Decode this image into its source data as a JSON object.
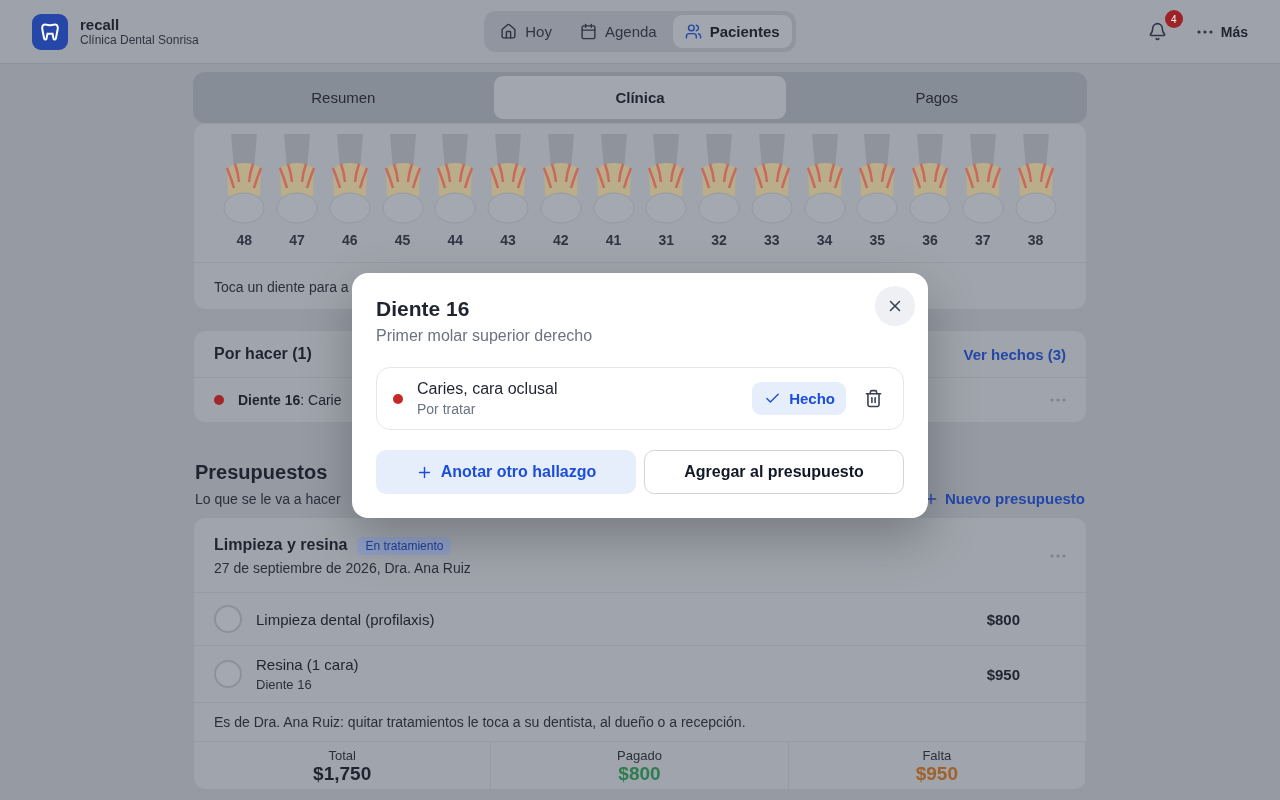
{
  "header": {
    "app_name": "recall",
    "clinic": "Clínica Dental Sonrisa",
    "nav": [
      {
        "label": "Hoy",
        "selected": false
      },
      {
        "label": "Agenda",
        "selected": false
      },
      {
        "label": "Pacientes",
        "selected": true
      }
    ],
    "notifications": "4",
    "more": "Más"
  },
  "tabs": [
    {
      "label": "Resumen",
      "selected": false
    },
    {
      "label": "Clínica",
      "selected": true
    },
    {
      "label": "Pagos",
      "selected": false
    }
  ],
  "odontogram": {
    "teeth": [
      "48",
      "47",
      "46",
      "45",
      "44",
      "43",
      "42",
      "41",
      "31",
      "32",
      "33",
      "34",
      "35",
      "36",
      "37",
      "38"
    ],
    "hint": "Toca un diente para a"
  },
  "todo": {
    "title": "Por hacer (1)",
    "link": "Ver hechos (3)",
    "items": [
      {
        "text": "**Diente 16**: Carie",
        "color": "#a3262a"
      }
    ]
  },
  "budgets": {
    "title": "Presupuestos",
    "subtitle": "Lo que se le va a hacer",
    "new_button": "Nuevo presupuesto",
    "cards": [
      {
        "title": "Limpieza y resina",
        "status": "En tratamiento",
        "meta": "27 de septiembre de 2026, Dra. Ana Ruiz",
        "items": [
          {
            "name": "Limpieza dental (profilaxis)",
            "price": "$800",
            "checked": false
          },
          {
            "name": "Resina (1 cara)",
            "detail": "Diente 16",
            "price": "$950",
            "checked": false
          }
        ],
        "note": "Es de Dra. Ana Ruiz: quitar tratamientos le toca a su dentista, al dueño o a recepción.",
        "totals": [
          {
            "label": "Total",
            "value": "$1,750",
            "color": "#1f2430"
          },
          {
            "label": "Pagado",
            "value": "$800",
            "color": "#2e7d4f"
          },
          {
            "label": "Falta",
            "value": "$950",
            "color": "#a0622a"
          }
        ]
      }
    ]
  },
  "modal": {
    "title": "Diente 16",
    "subtitle": "Primer molar superior derecho",
    "findings": [
      {
        "name": "Caries, cara oclusal",
        "status": "Por tratar",
        "color": "#c62828",
        "done_label": "Hecho"
      }
    ],
    "add_button": "Anotar otro hallazgo",
    "budget_button": "Agregar al presupuesto"
  }
}
